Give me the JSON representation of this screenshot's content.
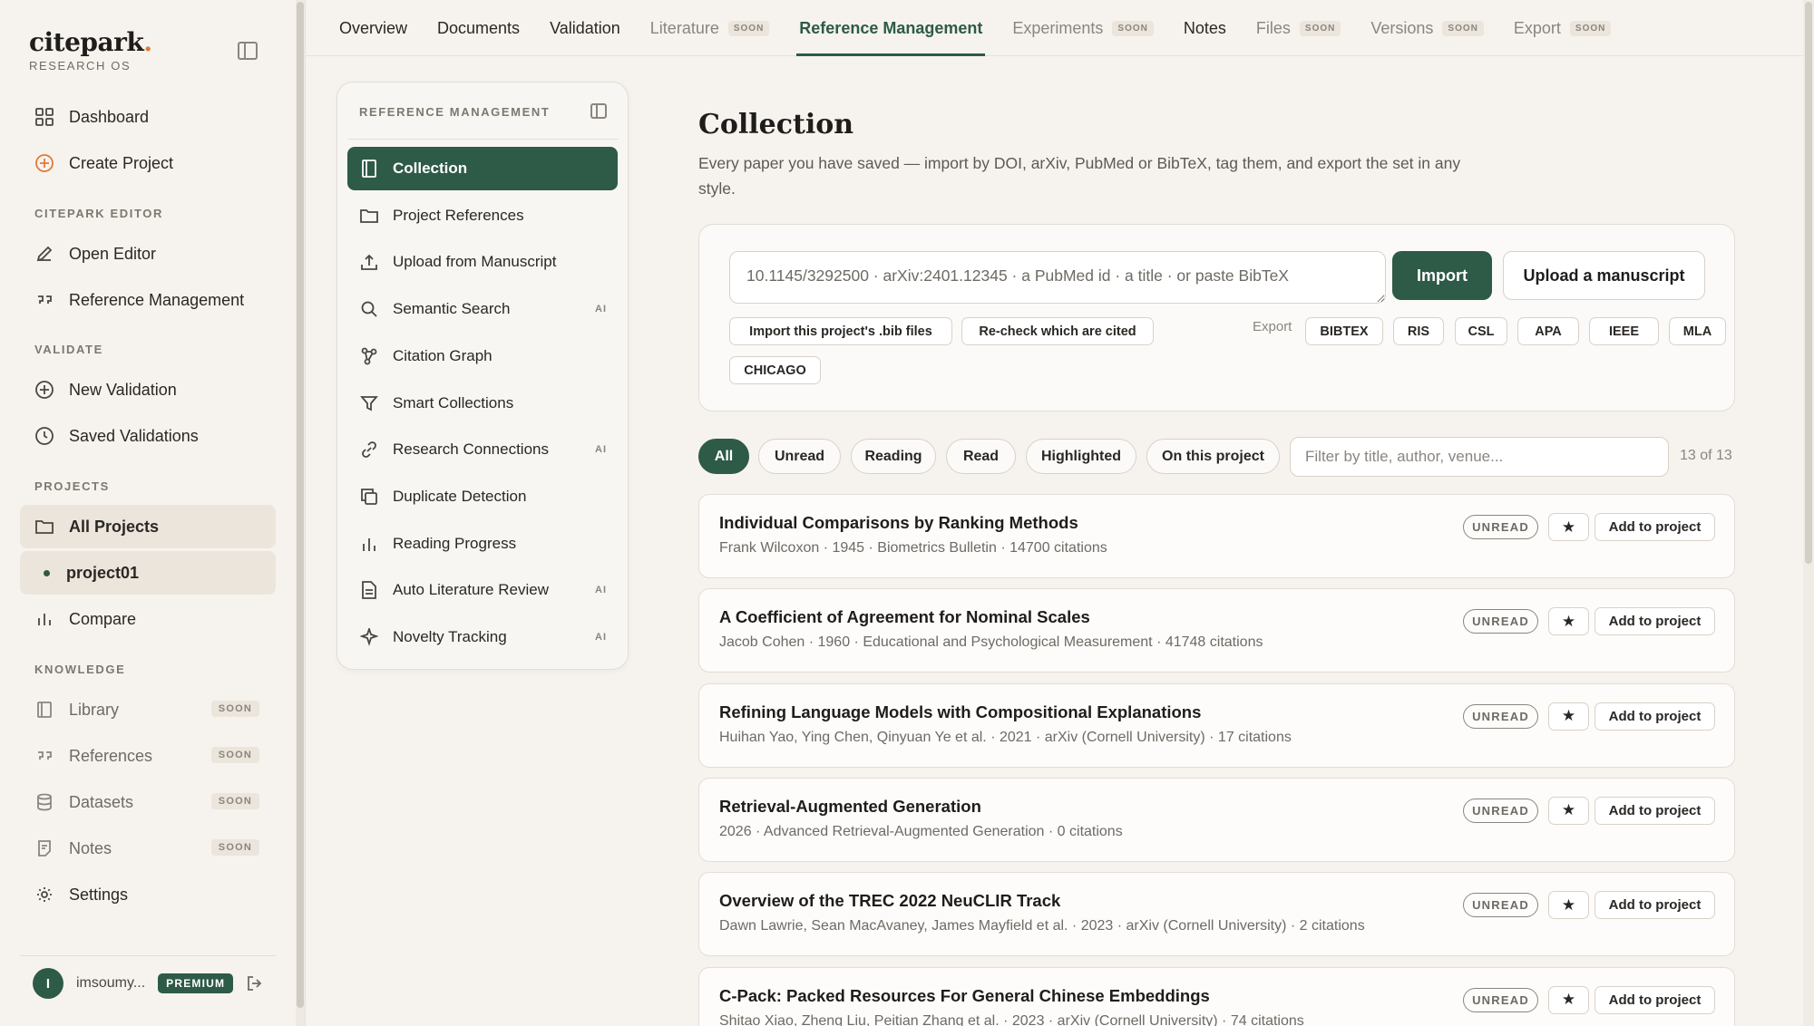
{
  "app": {
    "brand_name": "citepark",
    "brand_dot": ".",
    "brand_sub": "RESEARCH OS",
    "accent": "#2e5a48",
    "brand_dot_color": "#e07a3a"
  },
  "sidebar": {
    "top_items": [
      {
        "label": "Dashboard",
        "icon": "grid-icon"
      },
      {
        "label": "Create Project",
        "icon": "plus-circle-icon"
      }
    ],
    "sections": {
      "editor": "CITEPARK EDITOR",
      "validate": "VALIDATE",
      "projects": "PROJECTS",
      "knowledge": "KNOWLEDGE"
    },
    "editor_items": [
      {
        "label": "Open Editor",
        "icon": "pen-icon"
      },
      {
        "label": "Reference Management",
        "icon": "quote-icon"
      }
    ],
    "validate_items": [
      {
        "label": "New Validation",
        "icon": "plus-circle-icon"
      },
      {
        "label": "Saved Validations",
        "icon": "clock-icon"
      }
    ],
    "project_items": [
      {
        "label": "All Projects",
        "icon": "folder-icon"
      },
      {
        "label": "project01"
      },
      {
        "label": "Compare",
        "icon": "bar-chart-icon"
      }
    ],
    "knowledge_items": [
      {
        "label": "Library",
        "badge": "SOON",
        "icon": "book-icon"
      },
      {
        "label": "References",
        "badge": "SOON",
        "icon": "quote-icon"
      },
      {
        "label": "Datasets",
        "badge": "SOON",
        "icon": "database-icon"
      },
      {
        "label": "Notes",
        "badge": "SOON",
        "icon": "note-icon"
      }
    ],
    "settings_label": "Settings",
    "user": {
      "initial": "I",
      "name": "imsoumy...",
      "plan": "PREMIUM"
    }
  },
  "tabs": [
    {
      "label": "Overview"
    },
    {
      "label": "Documents"
    },
    {
      "label": "Validation"
    },
    {
      "label": "Literature",
      "badge": "SOON"
    },
    {
      "label": "Reference Management",
      "active": true
    },
    {
      "label": "Experiments",
      "badge": "SOON"
    },
    {
      "label": "Notes"
    },
    {
      "label": "Files",
      "badge": "SOON"
    },
    {
      "label": "Versions",
      "badge": "SOON"
    },
    {
      "label": "Export",
      "badge": "SOON"
    }
  ],
  "subpanel": {
    "title": "REFERENCE MANAGEMENT",
    "items": [
      {
        "label": "Collection",
        "icon": "book-icon",
        "active": true
      },
      {
        "label": "Project References",
        "icon": "folder-icon"
      },
      {
        "label": "Upload from Manuscript",
        "icon": "upload-icon"
      },
      {
        "label": "Semantic Search",
        "icon": "search-icon",
        "ai": "AI"
      },
      {
        "label": "Citation Graph",
        "icon": "graph-icon"
      },
      {
        "label": "Smart Collections",
        "icon": "filter-icon"
      },
      {
        "label": "Research Connections",
        "icon": "link-icon",
        "ai": "AI"
      },
      {
        "label": "Duplicate Detection",
        "icon": "copy-icon"
      },
      {
        "label": "Reading Progress",
        "icon": "bar-chart-icon"
      },
      {
        "label": "Auto Literature Review",
        "icon": "document-icon",
        "ai": "AI"
      },
      {
        "label": "Novelty Tracking",
        "icon": "sparkle-icon",
        "ai": "AI"
      }
    ]
  },
  "main": {
    "title": "Collection",
    "description": "Every paper you have saved — import by DOI, arXiv, PubMed or BibTeX, tag them, and export the set in any style.",
    "import": {
      "placeholder": "10.1145/3292500 · arXiv:2401.12345 · a PubMed id · a title · or paste BibTeX",
      "import_label": "Import",
      "upload_label": "Upload a manuscript",
      "import_bib_label": "Import this project's .bib files",
      "recheck_label": "Re-check which are cited",
      "export_label": "Export",
      "export_formats": [
        "BIBTEX",
        "RIS",
        "CSL",
        "APA",
        "IEEE",
        "MLA",
        "CHICAGO"
      ]
    },
    "filters": [
      "All",
      "Unread",
      "Reading",
      "Read",
      "Highlighted",
      "On this project"
    ],
    "filter_placeholder": "Filter by title, author, venue...",
    "count": "13 of 13",
    "papers": [
      {
        "title": "Individual Comparisons by Ranking Methods",
        "meta": "Frank Wilcoxon · 1945 · Biometrics Bulletin · 14700 citations",
        "status": "UNREAD"
      },
      {
        "title": "A Coefficient of Agreement for Nominal Scales",
        "meta": "Jacob Cohen · 1960 · Educational and Psychological Measurement · 41748 citations",
        "status": "UNREAD"
      },
      {
        "title": "Refining Language Models with Compositional Explanations",
        "meta": "Huihan Yao, Ying Chen, Qinyuan Ye et al. · 2021 · arXiv (Cornell University) · 17 citations",
        "status": "UNREAD"
      },
      {
        "title": "Retrieval-Augmented Generation",
        "meta": "2026 · Advanced Retrieval-Augmented Generation · 0 citations",
        "status": "UNREAD"
      },
      {
        "title": "Overview of the TREC 2022 NeuCLIR Track",
        "meta": "Dawn Lawrie, Sean MacAvaney, James Mayfield et al. · 2023 · arXiv (Cornell University) · 2 citations",
        "status": "UNREAD"
      },
      {
        "title": "C-Pack: Packed Resources For General Chinese Embeddings",
        "meta": "Shitao Xiao, Zheng Liu, Peitian Zhang et al. · 2023 · arXiv (Cornell University) · 74 citations",
        "status": "UNREAD"
      }
    ],
    "star_glyph": "★",
    "add_label": "Add to project"
  }
}
